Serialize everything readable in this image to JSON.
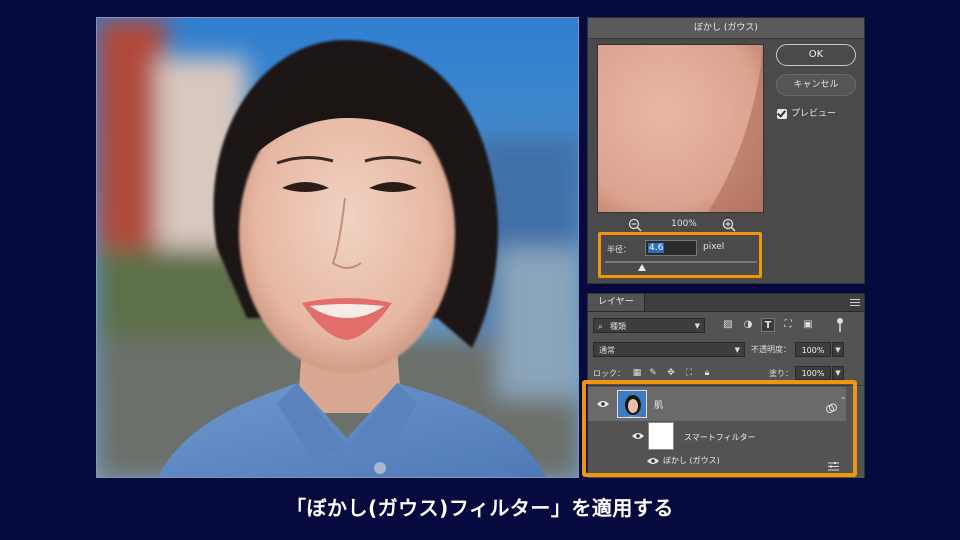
{
  "dialog": {
    "title": "ぼかし (ガウス)",
    "ok_label": "OK",
    "cancel_label": "キャンセル",
    "preview_label": "プレビュー",
    "zoom_level": "100%",
    "radius_label": "半径：",
    "radius_value": "4.6",
    "radius_unit": "pixel"
  },
  "layers_panel": {
    "tab_label": "レイヤー",
    "kind_filter": "種類",
    "blend_mode": "通常",
    "opacity_label": "不透明度：",
    "opacity_value": "100%",
    "lock_label": "ロック：",
    "fill_label": "塗り：",
    "fill_value": "100%",
    "layers": [
      {
        "name": "肌"
      },
      {
        "name": "スマートフィルター"
      },
      {
        "name": "ぼかし (ガウス)"
      }
    ]
  },
  "caption": "「ぼかし(ガウス)フィルター」を適用する",
  "colors": {
    "background": "#060a3e",
    "highlight": "#f0960c",
    "selection": "#2b6bd0"
  }
}
